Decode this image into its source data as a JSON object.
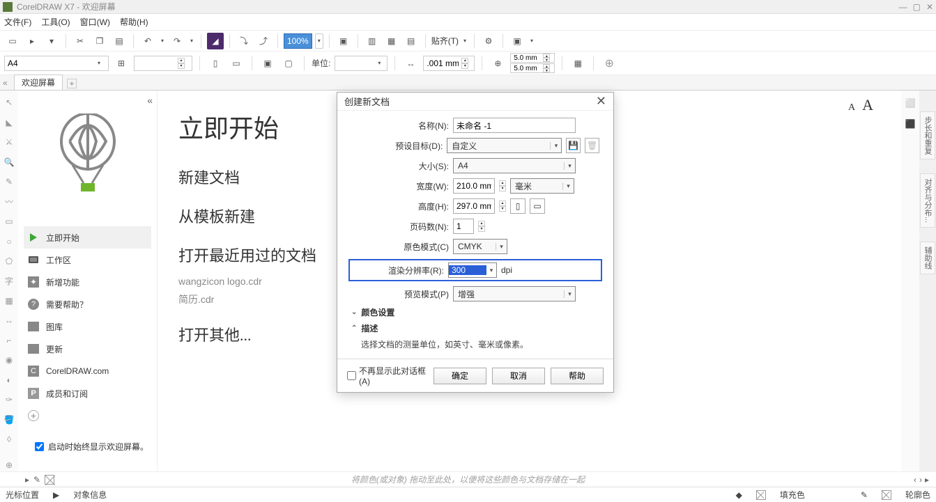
{
  "titlebar": {
    "title": "CorelDRAW X7 - 欢迎屏幕"
  },
  "menubar": {
    "file": "文件(F)",
    "tools": "工具(O)",
    "window": "窗口(W)",
    "help": "帮助(H)"
  },
  "toolbar1": {
    "zoom": "100%",
    "align": "贴齐(T)"
  },
  "propbar": {
    "page_size": "A4",
    "unit_label": "单位:",
    "nudge": ".001 mm",
    "dupx": "5.0 mm",
    "dupy": "5.0 mm"
  },
  "tab": {
    "welcome": "欢迎屏幕"
  },
  "welcome_side": {
    "items": [
      {
        "label": "立即开始",
        "active": true,
        "icon": "play"
      },
      {
        "label": "工作区",
        "icon": "sq"
      },
      {
        "label": "新增功能",
        "icon": "star"
      },
      {
        "label": "需要帮助？",
        "icon": "q"
      },
      {
        "label": "图库",
        "icon": "img"
      },
      {
        "label": "更新",
        "icon": "up"
      },
      {
        "label": "CorelDRAW.com",
        "icon": "c"
      },
      {
        "label": "成员和订阅",
        "icon": "p"
      }
    ],
    "show_on_start": "启动时始终显示欢迎屏幕。"
  },
  "welcome_content": {
    "title": "立即开始",
    "new_doc": "新建文档",
    "from_template": "从模板新建",
    "open_recent": "打开最近用过的文档",
    "recents": [
      "wangzicon logo.cdr",
      "简历.cdr"
    ],
    "open_other": "打开其他..."
  },
  "right_dock": {
    "t1": "步长和重复",
    "t2": "对齐与分布...",
    "t3": "辅助线"
  },
  "dialog": {
    "title": "创建新文档",
    "name_lbl": "名称(N):",
    "name_val": "未命名 -1",
    "preset_lbl": "预设目标(D):",
    "preset_val": "自定义",
    "size_lbl": "大小(S):",
    "size_val": "A4",
    "width_lbl": "宽度(W):",
    "width_val": "210.0 mm",
    "unit_val": "毫米",
    "height_lbl": "高度(H):",
    "height_val": "297.0 mm",
    "pages_lbl": "页码数(N):",
    "pages_val": "1",
    "colormode_lbl": "原色模式(C)",
    "colormode_val": "CMYK",
    "res_lbl": "渲染分辨率(R):",
    "res_val": "300",
    "res_unit": "dpi",
    "preview_lbl": "预览模式(P)",
    "preview_val": "增强",
    "color_section": "颜色设置",
    "desc_section": "描述",
    "desc_text": "选择文档的测量单位，如英寸、毫米或像素。",
    "dont_show": "不再显示此对话框(A)",
    "ok": "确定",
    "cancel": "取消",
    "help": "帮助"
  },
  "palette_hint": "将颜色(或对象) 拖动至此处，以便将这些颜色与文档存储在一起",
  "status": {
    "cursor": "光标位置",
    "obj": "对象信息",
    "fill": "填充色",
    "outline": "轮廓色"
  }
}
